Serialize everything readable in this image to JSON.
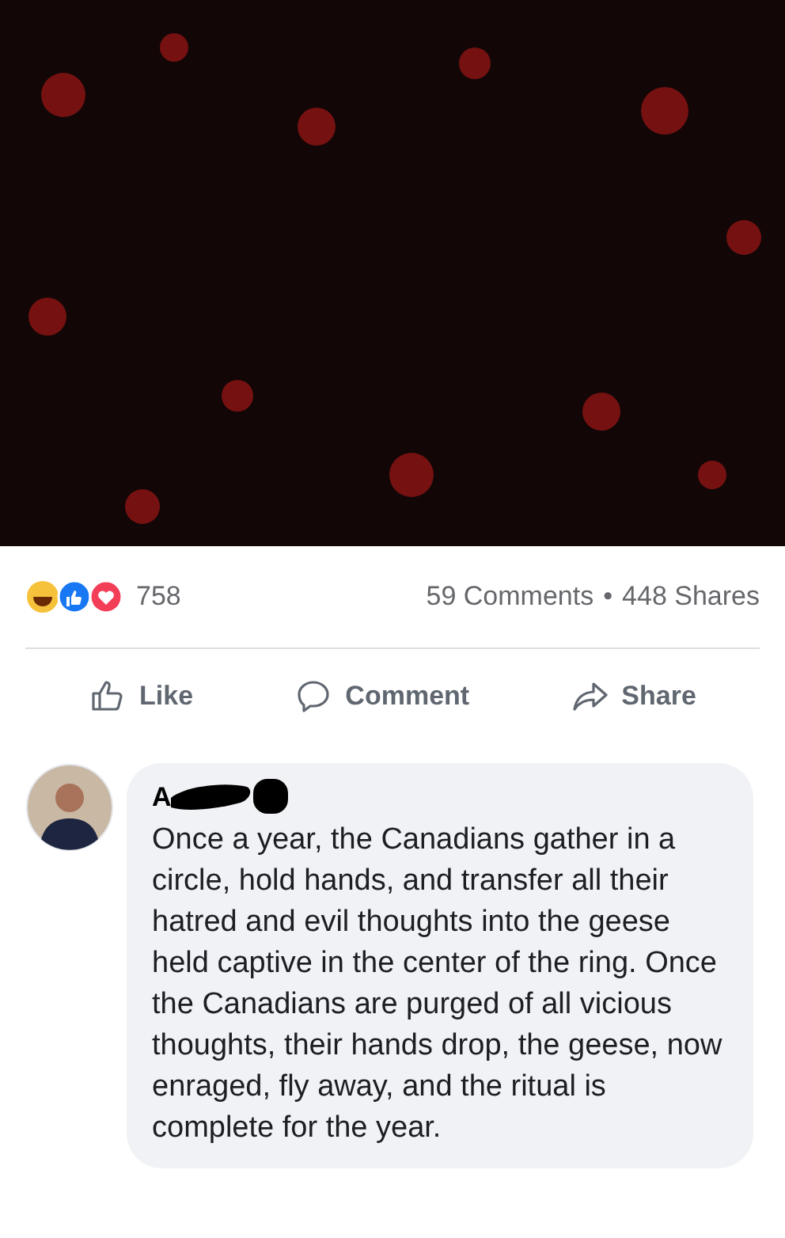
{
  "post": {
    "reaction_count": "758",
    "comments_count": "59 Comments",
    "separator": "•",
    "shares_count": "448 Shares"
  },
  "actions": [
    {
      "kind": "like",
      "label": "Like"
    },
    {
      "kind": "comment",
      "label": "Comment"
    },
    {
      "kind": "share",
      "label": "Share"
    }
  ],
  "comment": {
    "author": "A",
    "text": "Once a year, the Canadians gather in a circle, hold hands, and transfer all their hatred and evil thoughts into the geese held captive in the center of the ring. Once the Canadians are purged of all vicious thoughts, their hands drop, the geese, now enraged, fly away, and the ritual is complete for the year."
  }
}
